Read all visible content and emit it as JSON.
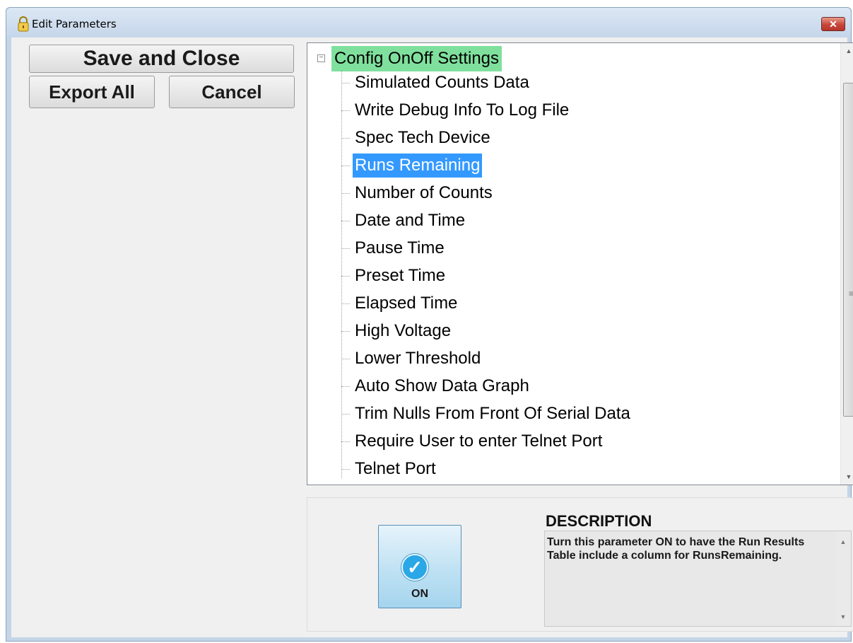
{
  "window": {
    "title": "Edit Parameters",
    "title_icon": "lock-icon",
    "close_icon": "close-icon",
    "close_glyph": "✕"
  },
  "buttons": {
    "save_and_close": "Save and Close",
    "export_all": "Export All",
    "cancel": "Cancel"
  },
  "tree": {
    "root_label": "Config OnOff Settings",
    "root_expanded": true,
    "root_toggle_glyph": "−",
    "root_highlight_color": "#7fe09d",
    "selection_color": "#3399ff",
    "items": [
      {
        "label": "Simulated Counts Data",
        "selected": false
      },
      {
        "label": "Write Debug Info To Log File",
        "selected": false
      },
      {
        "label": "Spec Tech Device",
        "selected": false
      },
      {
        "label": "Runs Remaining",
        "selected": true
      },
      {
        "label": "Number of Counts",
        "selected": false
      },
      {
        "label": "Date and Time",
        "selected": false
      },
      {
        "label": "Pause Time",
        "selected": false
      },
      {
        "label": "Preset Time",
        "selected": false
      },
      {
        "label": "Elapsed Time",
        "selected": false
      },
      {
        "label": "High Voltage",
        "selected": false
      },
      {
        "label": "Lower Threshold",
        "selected": false
      },
      {
        "label": "Auto Show Data Graph",
        "selected": false
      },
      {
        "label": "Trim Nulls From Front Of Serial Data",
        "selected": false
      },
      {
        "label": "Require User to enter Telnet Port",
        "selected": false
      },
      {
        "label": "Telnet Port",
        "selected": false
      }
    ]
  },
  "toggle": {
    "state_label": "ON",
    "icon": "checkmark-icon",
    "icon_glyph": "✓"
  },
  "description": {
    "heading": "DESCRIPTION",
    "text": "Turn this parameter ON to have the Run Results Table include a column for RunsRemaining."
  }
}
